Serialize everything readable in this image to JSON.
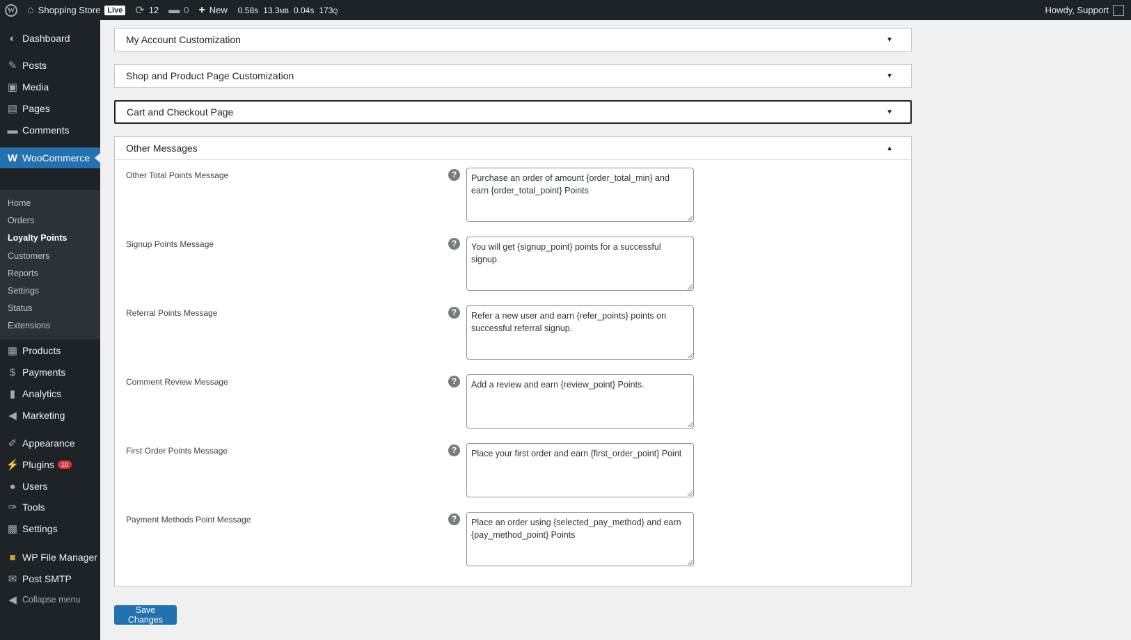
{
  "adminbar": {
    "site_name": "Shopping Store",
    "live_label": "Live",
    "updates_count": "12",
    "comments_count": "0",
    "new_label": "New",
    "qm_time": "0.58s",
    "qm_memory": "13.3",
    "qm_memory_unit": "MB",
    "qm_query_time": "0.04s",
    "qm_queries": "173",
    "qm_queries_unit": "Q",
    "howdy": "Howdy, Support"
  },
  "sidebar": {
    "dashboard": "Dashboard",
    "posts": "Posts",
    "media": "Media",
    "pages": "Pages",
    "comments": "Comments",
    "woocommerce": "WooCommerce",
    "submenu": [
      "Home",
      "Orders",
      "Loyalty Points",
      "Customers",
      "Reports",
      "Settings",
      "Status",
      "Extensions"
    ],
    "products": "Products",
    "payments": "Payments",
    "analytics": "Analytics",
    "marketing": "Marketing",
    "appearance": "Appearance",
    "plugins": "Plugins",
    "plugins_badge": "10",
    "users": "Users",
    "tools": "Tools",
    "settings": "Settings",
    "wp_file_manager": "WP File Manager",
    "post_smtp": "Post SMTP",
    "collapse": "Collapse menu"
  },
  "sections": {
    "my_account": "My Account Customization",
    "shop_product": "Shop and Product Page Customization",
    "cart_checkout": "Cart and Checkout Page",
    "other_messages": "Other Messages"
  },
  "fields": [
    {
      "label": "Other Total Points Message",
      "value": "Purchase an order of amount {order_total_min} and earn {order_total_point} Points"
    },
    {
      "label": "Signup Points Message",
      "value": "You will get {signup_point} points for a successful signup."
    },
    {
      "label": "Referral Points Message",
      "value": "Refer a new user and earn {refer_points} points on successful referral signup."
    },
    {
      "label": "Comment Review Message",
      "value": "Add a review and earn {review_point} Points."
    },
    {
      "label": "First Order Points Message",
      "value": "Place your first order and earn {first_order_point} Point"
    },
    {
      "label": "Payment Methods Point Message",
      "value": "Place an order using {selected_pay_method} and earn {pay_method_point} Points"
    }
  ],
  "help_glyph": "?",
  "save_label": "Save Changes",
  "colors": {
    "admin_bg": "#1d2327",
    "accent": "#2271b1",
    "page_bg": "#f0f0f1"
  }
}
